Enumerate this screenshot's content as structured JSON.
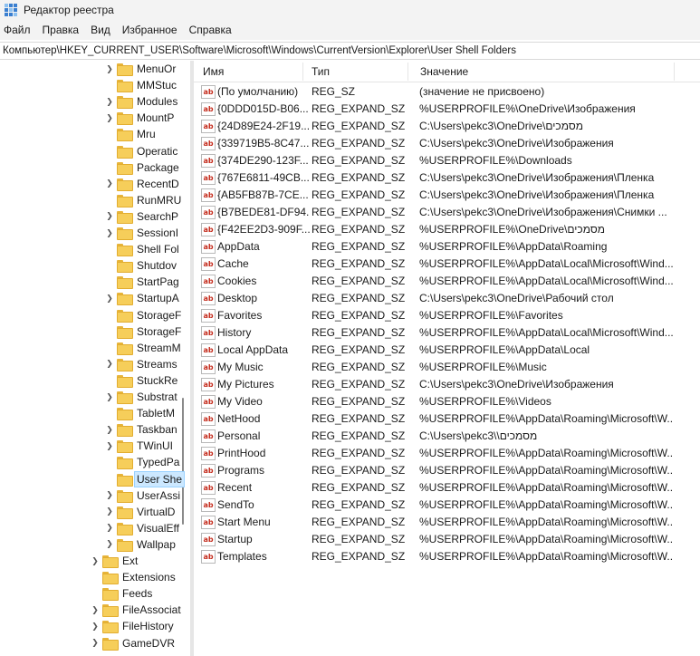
{
  "window": {
    "title": "Редактор реестра"
  },
  "menu": [
    "Файл",
    "Правка",
    "Вид",
    "Избранное",
    "Справка"
  ],
  "address": "Компьютер\\HKEY_CURRENT_USER\\Software\\Microsoft\\Windows\\CurrentVersion\\Explorer\\User Shell Folders",
  "columns": {
    "name": "Имя",
    "type": "Тип",
    "value": "Значение"
  },
  "tree": [
    {
      "label": "MenuOr",
      "level": 2,
      "expand": true
    },
    {
      "label": "MMStuc",
      "level": 2,
      "expand": false
    },
    {
      "label": "Modules",
      "level": 2,
      "expand": true
    },
    {
      "label": "MountP",
      "level": 2,
      "expand": true
    },
    {
      "label": "Mru",
      "level": 2,
      "expand": false
    },
    {
      "label": "Operatic",
      "level": 2,
      "expand": false
    },
    {
      "label": "Package",
      "level": 2,
      "expand": false
    },
    {
      "label": "RecentD",
      "level": 2,
      "expand": true
    },
    {
      "label": "RunMRU",
      "level": 2,
      "expand": false
    },
    {
      "label": "SearchP",
      "level": 2,
      "expand": true
    },
    {
      "label": "SessionI",
      "level": 2,
      "expand": true
    },
    {
      "label": "Shell Fol",
      "level": 2,
      "expand": false
    },
    {
      "label": "Shutdov",
      "level": 2,
      "expand": false
    },
    {
      "label": "StartPag",
      "level": 2,
      "expand": false
    },
    {
      "label": "StartupA",
      "level": 2,
      "expand": true
    },
    {
      "label": "StorageF",
      "level": 2,
      "expand": false
    },
    {
      "label": "StorageF",
      "level": 2,
      "expand": false
    },
    {
      "label": "StreamM",
      "level": 2,
      "expand": false
    },
    {
      "label": "Streams",
      "level": 2,
      "expand": true
    },
    {
      "label": "StuckRe",
      "level": 2,
      "expand": false
    },
    {
      "label": "Substrat",
      "level": 2,
      "expand": true
    },
    {
      "label": "TabletM",
      "level": 2,
      "expand": false
    },
    {
      "label": "Taskban",
      "level": 2,
      "expand": true
    },
    {
      "label": "TWinUI",
      "level": 2,
      "expand": true
    },
    {
      "label": "TypedPa",
      "level": 2,
      "expand": false
    },
    {
      "label": "User She",
      "level": 2,
      "expand": false,
      "selected": true
    },
    {
      "label": "UserAssi",
      "level": 2,
      "expand": true
    },
    {
      "label": "VirtualD",
      "level": 2,
      "expand": true
    },
    {
      "label": "VisualEff",
      "level": 2,
      "expand": true
    },
    {
      "label": "Wallpap",
      "level": 2,
      "expand": true
    },
    {
      "label": "Ext",
      "level": 1,
      "expand": true
    },
    {
      "label": "Extensions",
      "level": 1,
      "expand": false
    },
    {
      "label": "Feeds",
      "level": 1,
      "expand": false
    },
    {
      "label": "FileAssociat",
      "level": 1,
      "expand": true
    },
    {
      "label": "FileHistory",
      "level": 1,
      "expand": true
    },
    {
      "label": "GameDVR",
      "level": 1,
      "expand": true
    }
  ],
  "entries": [
    {
      "name": "(По умолчанию)",
      "type": "REG_SZ",
      "value": "(значение не присвоено)"
    },
    {
      "name": "{0DDD015D-B06...",
      "type": "REG_EXPAND_SZ",
      "value": "%USERPROFILE%\\OneDrive\\Изображения"
    },
    {
      "name": "{24D89E24-2F19...",
      "type": "REG_EXPAND_SZ",
      "value": "C:\\Users\\pekc3\\OneDrive\\מסמכים"
    },
    {
      "name": "{339719B5-8C47...",
      "type": "REG_EXPAND_SZ",
      "value": "C:\\Users\\pekc3\\OneDrive\\Изображения"
    },
    {
      "name": "{374DE290-123F...",
      "type": "REG_EXPAND_SZ",
      "value": "%USERPROFILE%\\Downloads"
    },
    {
      "name": "{767E6811-49CB...",
      "type": "REG_EXPAND_SZ",
      "value": "C:\\Users\\pekc3\\OneDrive\\Изображения\\Пленка"
    },
    {
      "name": "{AB5FB87B-7CE...",
      "type": "REG_EXPAND_SZ",
      "value": "C:\\Users\\pekc3\\OneDrive\\Изображения\\Пленка"
    },
    {
      "name": "{B7BEDE81-DF94...",
      "type": "REG_EXPAND_SZ",
      "value": "C:\\Users\\pekc3\\OneDrive\\Изображения\\Снимки ..."
    },
    {
      "name": "{F42EE2D3-909F...",
      "type": "REG_EXPAND_SZ",
      "value": "%USERPROFILE%\\OneDrive\\מסמכים"
    },
    {
      "name": "AppData",
      "type": "REG_EXPAND_SZ",
      "value": "%USERPROFILE%\\AppData\\Roaming"
    },
    {
      "name": "Cache",
      "type": "REG_EXPAND_SZ",
      "value": "%USERPROFILE%\\AppData\\Local\\Microsoft\\Wind..."
    },
    {
      "name": "Cookies",
      "type": "REG_EXPAND_SZ",
      "value": "%USERPROFILE%\\AppData\\Local\\Microsoft\\Wind..."
    },
    {
      "name": "Desktop",
      "type": "REG_EXPAND_SZ",
      "value": "C:\\Users\\pekc3\\OneDrive\\Рабочий стол"
    },
    {
      "name": "Favorites",
      "type": "REG_EXPAND_SZ",
      "value": "%USERPROFILE%\\Favorites"
    },
    {
      "name": "History",
      "type": "REG_EXPAND_SZ",
      "value": "%USERPROFILE%\\AppData\\Local\\Microsoft\\Wind..."
    },
    {
      "name": "Local AppData",
      "type": "REG_EXPAND_SZ",
      "value": "%USERPROFILE%\\AppData\\Local"
    },
    {
      "name": "My Music",
      "type": "REG_EXPAND_SZ",
      "value": "%USERPROFILE%\\Music"
    },
    {
      "name": "My Pictures",
      "type": "REG_EXPAND_SZ",
      "value": "C:\\Users\\pekc3\\OneDrive\\Изображения"
    },
    {
      "name": "My Video",
      "type": "REG_EXPAND_SZ",
      "value": "%USERPROFILE%\\Videos"
    },
    {
      "name": "NetHood",
      "type": "REG_EXPAND_SZ",
      "value": "%USERPROFILE%\\AppData\\Roaming\\Microsoft\\W..."
    },
    {
      "name": "Personal",
      "type": "REG_EXPAND_SZ",
      "value": "C:\\Users\\pekc3\\\\מסמכים"
    },
    {
      "name": "PrintHood",
      "type": "REG_EXPAND_SZ",
      "value": "%USERPROFILE%\\AppData\\Roaming\\Microsoft\\W..."
    },
    {
      "name": "Programs",
      "type": "REG_EXPAND_SZ",
      "value": "%USERPROFILE%\\AppData\\Roaming\\Microsoft\\W..."
    },
    {
      "name": "Recent",
      "type": "REG_EXPAND_SZ",
      "value": "%USERPROFILE%\\AppData\\Roaming\\Microsoft\\W..."
    },
    {
      "name": "SendTo",
      "type": "REG_EXPAND_SZ",
      "value": "%USERPROFILE%\\AppData\\Roaming\\Microsoft\\W..."
    },
    {
      "name": "Start Menu",
      "type": "REG_EXPAND_SZ",
      "value": "%USERPROFILE%\\AppData\\Roaming\\Microsoft\\W..."
    },
    {
      "name": "Startup",
      "type": "REG_EXPAND_SZ",
      "value": "%USERPROFILE%\\AppData\\Roaming\\Microsoft\\W..."
    },
    {
      "name": "Templates",
      "type": "REG_EXPAND_SZ",
      "value": "%USERPROFILE%\\AppData\\Roaming\\Microsoft\\W..."
    }
  ],
  "icons": {
    "app": "registry-editor-icon",
    "folder": "folder-icon",
    "value": "string-value-icon",
    "expand": "chevron-right-icon"
  },
  "colors": {
    "selection": "#cce8ff",
    "folder": "#f6ce5a",
    "value_icon_text": "#c42b1c"
  }
}
